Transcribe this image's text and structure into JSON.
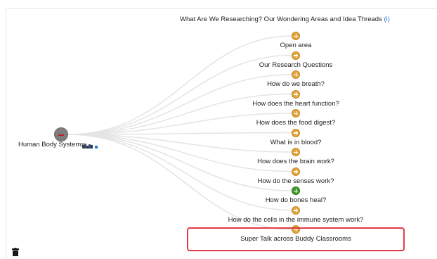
{
  "title": {
    "text": "What Are We Researching? Our Wondering Areas and Idea Threads",
    "info_label": "(i)"
  },
  "root": {
    "label": "Human Body Systems",
    "icon": "minus-icon"
  },
  "nodes": [
    {
      "label": "Open area",
      "state": "collapsed"
    },
    {
      "label": "Our Research Questions",
      "state": "collapsed"
    },
    {
      "label": "How do we breath?",
      "state": "collapsed"
    },
    {
      "label": "How does the heart function?",
      "state": "collapsed"
    },
    {
      "label": "How does the food digest?",
      "state": "collapsed"
    },
    {
      "label": "What is in blood?",
      "state": "collapsed"
    },
    {
      "label": "How does the brain work?",
      "state": "collapsed"
    },
    {
      "label": "How do the senses work?",
      "state": "collapsed"
    },
    {
      "label": "How do bones heal?",
      "state": "active"
    },
    {
      "label": "How do the cells in the immune system work?",
      "state": "collapsed"
    },
    {
      "label": "Super Talk across Buddy Classrooms",
      "state": "collapsed",
      "highlighted": true
    }
  ],
  "colors": {
    "node_collapsed": "#e1a53b",
    "node_active": "#3d9a2a",
    "root": "#7d7d7d",
    "highlight": "#e23b46",
    "info_link": "#2b7bd3"
  },
  "icons": {
    "delete": "trash-icon",
    "node_expand": "plus-icon",
    "root_collapse": "minus-icon"
  }
}
